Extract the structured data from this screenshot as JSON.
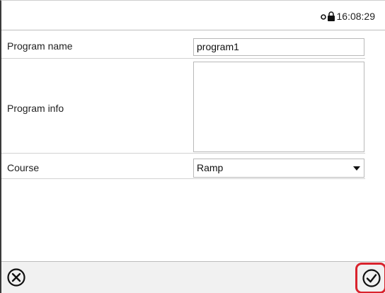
{
  "status_bar": {
    "lock_icon": "lock-icon",
    "time": "16:08:29"
  },
  "form": {
    "program_name": {
      "label": "Program name",
      "value": "program1"
    },
    "program_info": {
      "label": "Program info",
      "value": ""
    },
    "course": {
      "label": "Course",
      "value": "Ramp",
      "icon": "chevron-down-icon"
    }
  },
  "footer": {
    "cancel_icon": "close-circle-icon",
    "confirm_icon": "check-circle-icon",
    "confirm_highlight_color": "#d9232d"
  }
}
